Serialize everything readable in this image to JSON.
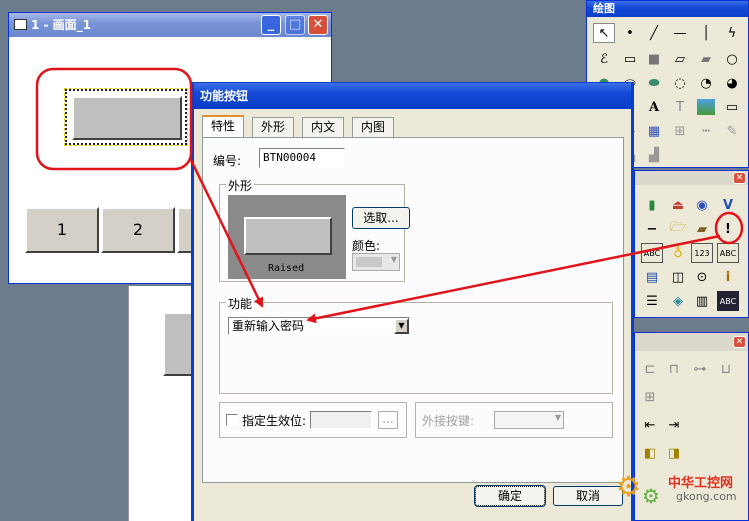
{
  "screen_window": {
    "title": "1 - 画面_1",
    "buttons": [
      "1",
      "2"
    ]
  },
  "dialog": {
    "title": "功能按钮",
    "tabs": [
      "特性",
      "外形",
      "内文",
      "内图"
    ],
    "number_label": "编号:",
    "number_value": "BTN00004",
    "shape_group": "外形",
    "preview_caption": "Raised",
    "select_button": "选取...",
    "color_label": "颜色:",
    "function_group": "功能",
    "function_value": "重新输入密码",
    "specify_effective_label": "指定生效位:",
    "browse_label": "...",
    "external_key_label": "外接按键:",
    "ok_button": "确定",
    "cancel_button": "取消"
  },
  "draw_palette": {
    "title": "绘图",
    "text_tool": "A"
  },
  "component_palette": {
    "v_label": "V",
    "exclaim_label": "!",
    "label_123": "123",
    "label_abc": "ABC",
    "label_abc2": "ABC"
  },
  "watermark": {
    "name": "中华工控网",
    "url": "gkong.com"
  },
  "colors": {
    "annotation": "#e0141a",
    "titlebar": "#0a3fc8"
  }
}
